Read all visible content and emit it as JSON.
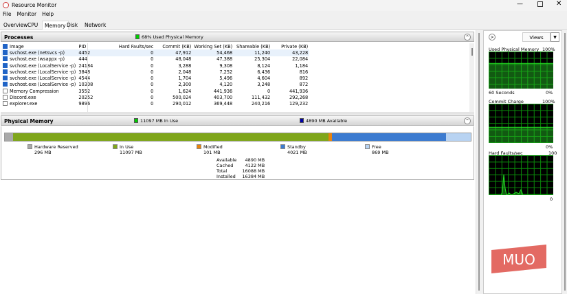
{
  "window": {
    "title": "Resource Monitor"
  },
  "menu": [
    "File",
    "Monitor",
    "Help"
  ],
  "tabs": [
    {
      "label": "Overview"
    },
    {
      "label": "CPU"
    },
    {
      "label": "Memory",
      "active": true
    },
    {
      "label": "Disk"
    },
    {
      "label": "Network"
    }
  ],
  "processes": {
    "title": "Processes",
    "status": "68% Used Physical Memory",
    "columns": [
      "Image",
      "PID",
      "Hard Faults/sec",
      "Commit (KB)",
      "Working Set (KB)",
      "Shareable (KB)",
      "Private (KB)"
    ],
    "rows": [
      {
        "checked": true,
        "cells": [
          "svchost.exe (netsvcs -p)",
          "4452",
          "0",
          "47,912",
          "54,468",
          "11,240",
          "43,228"
        ]
      },
      {
        "checked": true,
        "cells": [
          "svchost.exe (wsappx -p)",
          "444",
          "0",
          "48,048",
          "47,388",
          "25,304",
          "22,084"
        ]
      },
      {
        "checked": true,
        "cells": [
          "svchost.exe (LocalService -p)",
          "24184",
          "0",
          "3,288",
          "9,308",
          "8,124",
          "1,184"
        ]
      },
      {
        "checked": true,
        "cells": [
          "svchost.exe (LocalService -p)",
          "3848",
          "0",
          "2,048",
          "7,252",
          "6,436",
          "816"
        ]
      },
      {
        "checked": true,
        "cells": [
          "svchost.exe (LocalService -p)",
          "4544",
          "0",
          "1,704",
          "5,496",
          "4,604",
          "892"
        ]
      },
      {
        "checked": true,
        "cells": [
          "svchost.exe (LocalService -p)",
          "10308",
          "0",
          "2,300",
          "4,120",
          "3,248",
          "872"
        ]
      },
      {
        "checked": false,
        "cells": [
          "Memory Compression",
          "3552",
          "0",
          "1,624",
          "441,936",
          "0",
          "441,936"
        ]
      },
      {
        "checked": false,
        "cells": [
          "Discord.exe",
          "20252",
          "0",
          "500,024",
          "403,700",
          "111,432",
          "292,268"
        ]
      },
      {
        "checked": false,
        "cells": [
          "explorer.exe",
          "9896",
          "0",
          "290,012",
          "369,448",
          "240,216",
          "129,232"
        ]
      }
    ]
  },
  "physical_memory": {
    "title": "Physical Memory",
    "in_use_note": "11097 MB In Use",
    "available_note": "4890 MB Available",
    "segments": [
      {
        "label": "Hardware Reserved",
        "value": "296 MB",
        "mb": 296,
        "color": "#a9a9a9"
      },
      {
        "label": "In Use",
        "value": "11097 MB",
        "mb": 11097,
        "color": "#7fa61b"
      },
      {
        "label": "Modified",
        "value": "101 MB",
        "mb": 101,
        "color": "#e8830e"
      },
      {
        "label": "Standby",
        "value": "4021 MB",
        "mb": 4021,
        "color": "#3c7bd0"
      },
      {
        "label": "Free",
        "value": "869 MB",
        "mb": 869,
        "color": "#b8d3f2"
      }
    ],
    "summary": [
      [
        "Available",
        "4890 MB"
      ],
      [
        "Cached",
        "4122 MB"
      ],
      [
        "Total",
        "16088 MB"
      ],
      [
        "Installed",
        "16384 MB"
      ]
    ]
  },
  "side": {
    "views_label": "Views",
    "graphs": [
      {
        "title": "Used Physical Memory",
        "max": "100%",
        "min": "0%",
        "footer": "60 Seconds",
        "level_percent": 68
      },
      {
        "title": "Commit Charge",
        "max": "100%",
        "min": "0%",
        "level_percent": 40
      },
      {
        "title": "Hard Faults/sec",
        "max": "100",
        "min": "0"
      }
    ]
  },
  "watermark": "MUO",
  "colors": {
    "graph_line": "#22e022",
    "in_use_marker": "#00cc00",
    "available_marker": "#0000aa"
  }
}
